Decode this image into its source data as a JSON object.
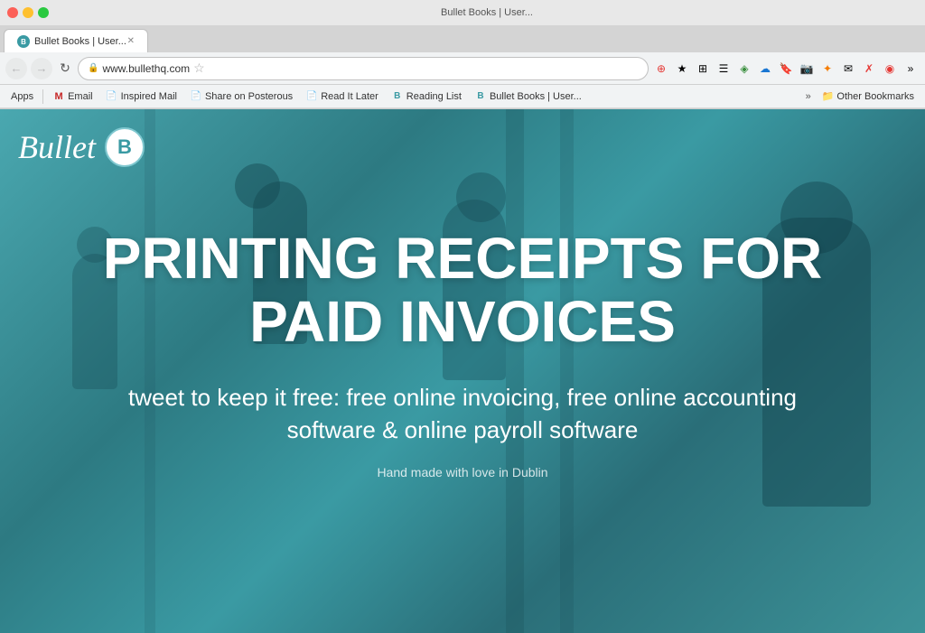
{
  "browser": {
    "url": "www.bullethq.com",
    "tab_title": "Bullet Books | User..."
  },
  "toolbar": {
    "back_label": "←",
    "forward_label": "→",
    "reload_label": "↻"
  },
  "bookmarks": {
    "apps_label": "Apps",
    "items": [
      {
        "id": "gmail",
        "label": "Email",
        "icon": "M"
      },
      {
        "id": "inspired-mail",
        "label": "Inspired Mail",
        "icon": "✉"
      },
      {
        "id": "share-on-posterous",
        "label": "Share on Posterous",
        "icon": "✎"
      },
      {
        "id": "read-it-later",
        "label": "Read It Later",
        "icon": "📄"
      },
      {
        "id": "reading-list",
        "label": "Reading List",
        "icon": "📋"
      },
      {
        "id": "bullet-books",
        "label": "Bullet Books | User...",
        "icon": "B"
      }
    ],
    "other_label": "Other Bookmarks"
  },
  "page": {
    "logo_text": "Bullet",
    "logo_badge": "B",
    "headline": "PRINTING RECEIPTS FOR PAID INVOICES",
    "subheadline": "tweet to keep it free: free online invoicing, free online accounting software & online payroll software",
    "footer": "Hand made with love in Dublin"
  }
}
